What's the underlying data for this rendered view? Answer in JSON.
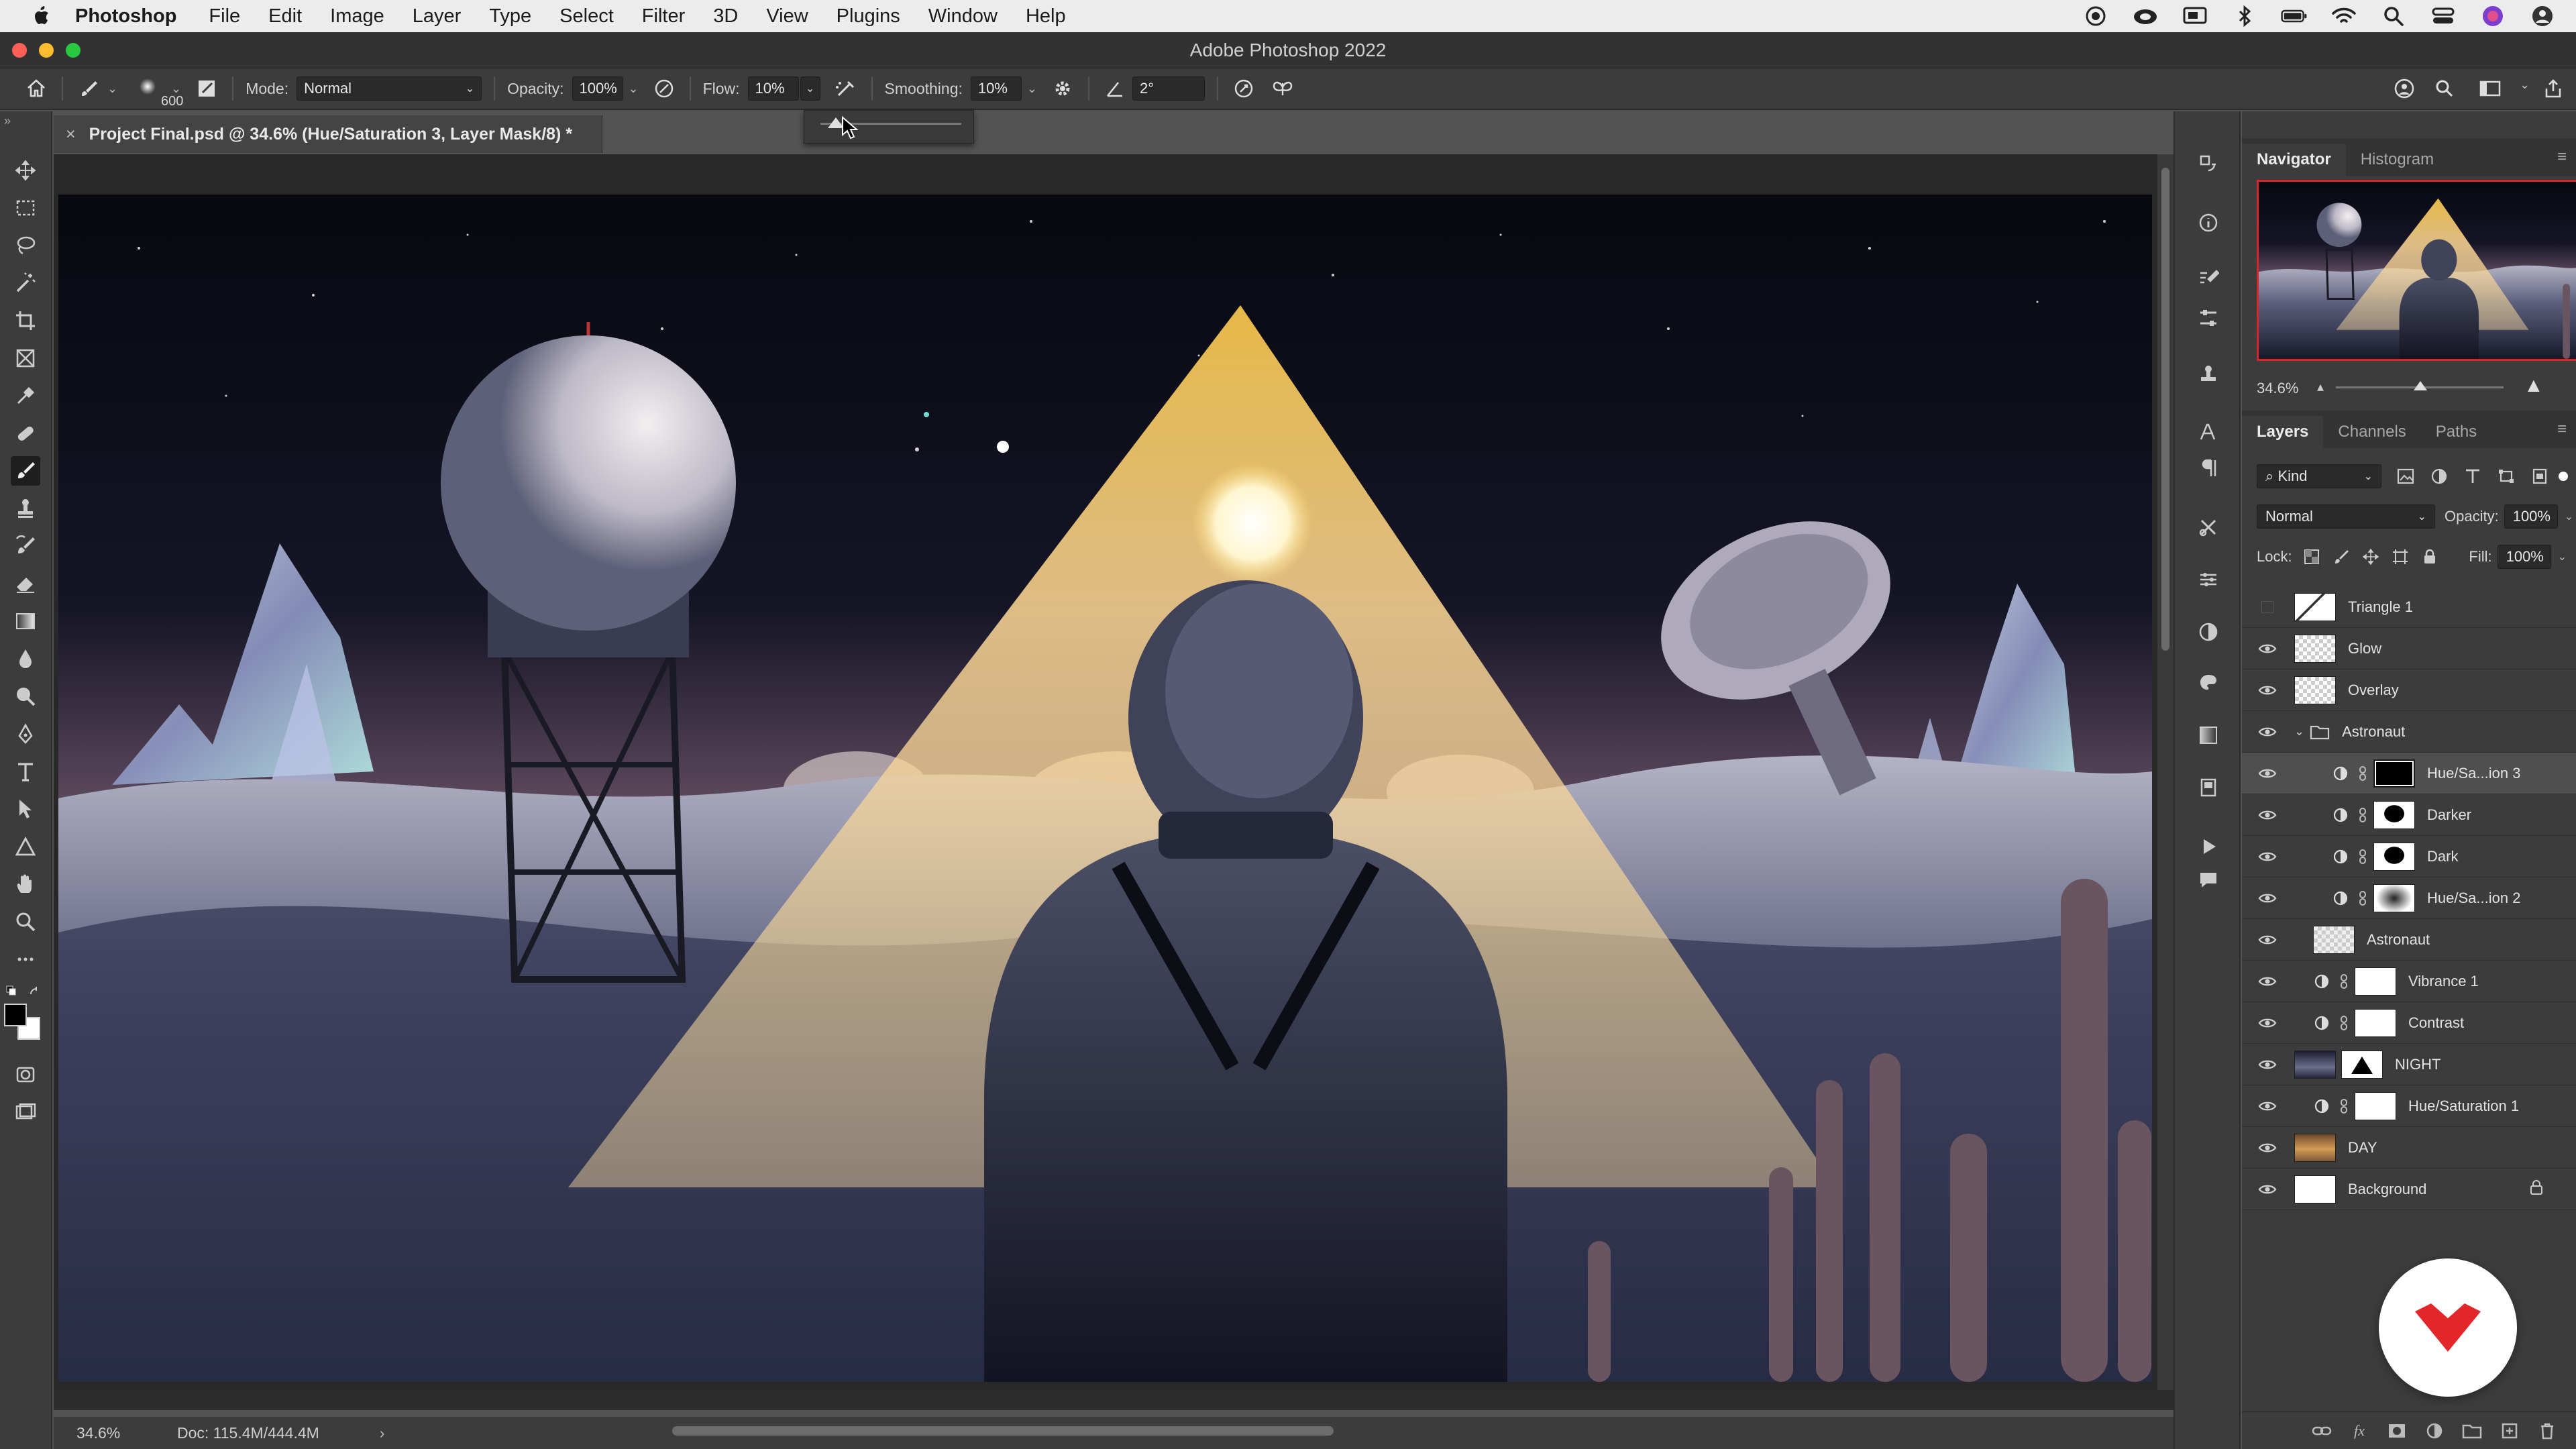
{
  "menubar": {
    "app": "Photoshop",
    "items": [
      "File",
      "Edit",
      "Image",
      "Layer",
      "Type",
      "Select",
      "Filter",
      "3D",
      "View",
      "Plugins",
      "Window",
      "Help"
    ]
  },
  "window": {
    "title": "Adobe Photoshop 2022"
  },
  "options": {
    "brush_size": "600",
    "mode_label": "Mode:",
    "mode_value": "Normal",
    "opacity_label": "Opacity:",
    "opacity_value": "100%",
    "flow_label": "Flow:",
    "flow_value": "10%",
    "smoothing_label": "Smoothing:",
    "smoothing_value": "10%",
    "angle_value": "2°",
    "flow_slider_level": 0.1
  },
  "document": {
    "tab_title": "Project Final.psd @ 34.6% (Hue/Saturation 3, Layer Mask/8) *",
    "zoom": "34.6%",
    "doc_size": "Doc: 115.4M/444.4M"
  },
  "navigator": {
    "tabs": [
      "Navigator",
      "Histogram"
    ],
    "zoom": "34.6%"
  },
  "layers_panel": {
    "tabs": [
      "Layers",
      "Channels",
      "Paths"
    ],
    "filter_kind": "Kind",
    "blend_mode": "Normal",
    "opacity_label": "Opacity:",
    "opacity_value": "100%",
    "lock_label": "Lock:",
    "fill_label": "Fill:",
    "fill_value": "100%",
    "layers": [
      {
        "name": "Triangle 1",
        "visible": false,
        "indent": 0,
        "type": "smart",
        "selected": false
      },
      {
        "name": "Glow",
        "visible": true,
        "indent": 0,
        "type": "transparent",
        "selected": false
      },
      {
        "name": "Overlay",
        "visible": true,
        "indent": 0,
        "type": "transparent",
        "selected": false
      },
      {
        "name": "Astronaut",
        "visible": true,
        "indent": 0,
        "type": "group",
        "selected": false
      },
      {
        "name": "Hue/Sa...ion 3",
        "visible": true,
        "indent": 2,
        "type": "adjust-black",
        "selected": true
      },
      {
        "name": "Darker",
        "visible": true,
        "indent": 2,
        "type": "adjust-silhouette",
        "selected": false
      },
      {
        "name": "Dark",
        "visible": true,
        "indent": 2,
        "type": "adjust-silhouette",
        "selected": false
      },
      {
        "name": "Hue/Sa...ion 2",
        "visible": true,
        "indent": 2,
        "type": "adjust-soft",
        "selected": false
      },
      {
        "name": "Astronaut",
        "visible": true,
        "indent": 1,
        "type": "pixel-astronaut",
        "selected": false
      },
      {
        "name": "Vibrance 1",
        "visible": true,
        "indent": 1,
        "type": "adjust-white",
        "selected": false
      },
      {
        "name": "Contrast",
        "visible": true,
        "indent": 1,
        "type": "adjust-white",
        "selected": false
      },
      {
        "name": "NIGHT",
        "visible": true,
        "indent": 0,
        "type": "pixel-night",
        "selected": false
      },
      {
        "name": "Hue/Saturation 1",
        "visible": true,
        "indent": 1,
        "type": "adjust-white",
        "selected": false
      },
      {
        "name": "DAY",
        "visible": true,
        "indent": 0,
        "type": "pixel-day",
        "selected": false
      },
      {
        "name": "Background",
        "visible": true,
        "indent": 0,
        "type": "background",
        "selected": false
      }
    ]
  },
  "colors": {
    "selection_red": "#d8262a",
    "badge_red": "#e3262a"
  }
}
